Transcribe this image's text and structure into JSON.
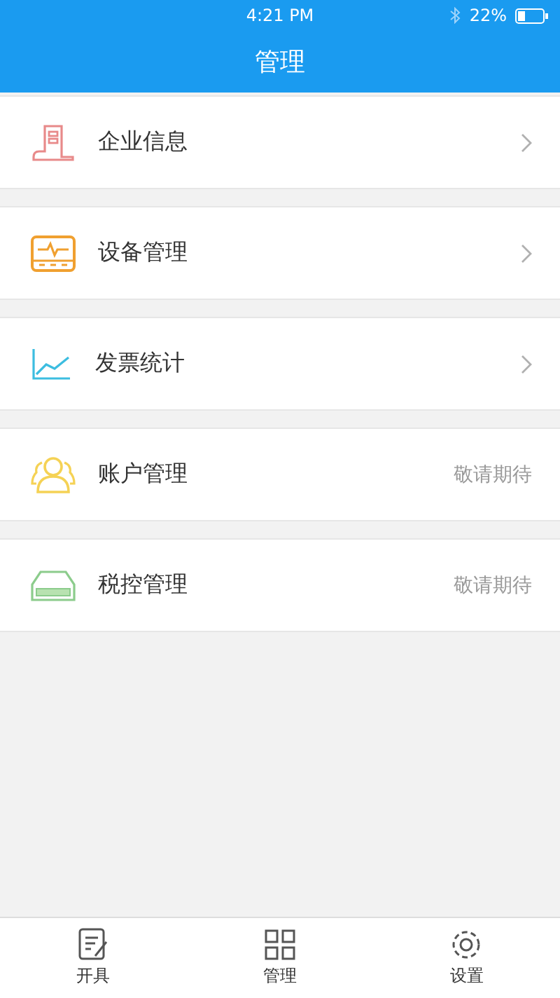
{
  "status_bar": {
    "time": "4:21 PM",
    "battery": "22%"
  },
  "title": "管理",
  "menu": [
    {
      "label": "企业信息",
      "kind": "link"
    },
    {
      "label": "设备管理",
      "kind": "link"
    },
    {
      "label": "发票统计",
      "kind": "link"
    },
    {
      "label": "账户管理",
      "kind": "pending",
      "note": "敬请期待"
    },
    {
      "label": "税控管理",
      "kind": "pending",
      "note": "敬请期待"
    }
  ],
  "tab_bar": [
    {
      "label": "开具"
    },
    {
      "label": "管理"
    },
    {
      "label": "设置"
    }
  ]
}
